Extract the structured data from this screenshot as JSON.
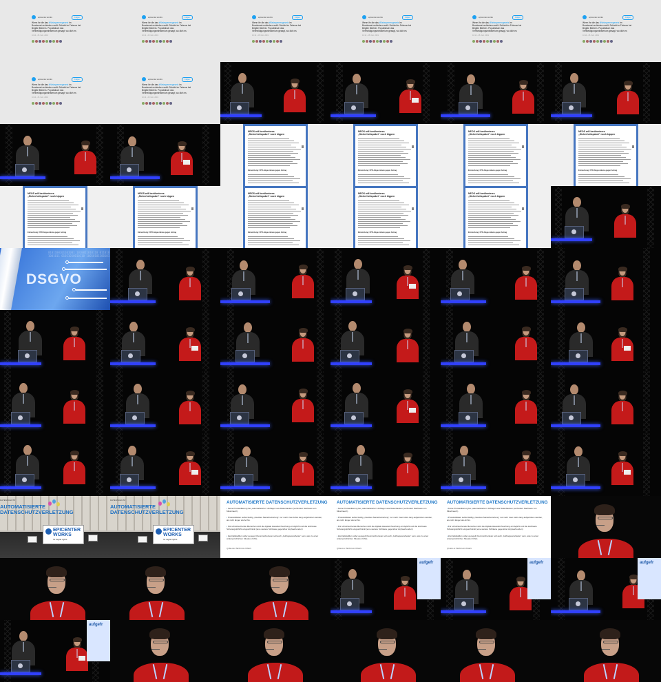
{
  "tweet": {
    "handle": "epicenter.works",
    "follow_label": "Folgen",
    "body_prefix": "Wenn ihr die das",
    "body_link": "#Netzsperrengesetz",
    "body_rest": "im Bundesrat verhindern wollt: Schickt im Februar bei Brigitte Bierlein. Populistisch das Vertheidigungsministerium gesagt, wo dich es",
    "time": "10:14 - 25. Feb. 2019"
  },
  "article": {
    "headline": "NEOS will berühmteres „Sicherheitspaket“ noch kippen",
    "subhead": "Einreichung: FPÖ-Abgeordnete gegen Antrag"
  },
  "dsgvo": {
    "label": "DSGVO",
    "binary": "0101100101101001 1010011010110 0110101001011 01011010010110 10010101100101"
  },
  "protest": {
    "banner_top": "DATENSCHUTZ",
    "title_line1": "AUTOMATISIERTE",
    "title_line2": "DATENSCHUTZVERLETZUNG",
    "epicenter_line1": "EPICENTER",
    "epicenter_line2": "WORKS",
    "epicenter_tagline": "for digital rights"
  },
  "slide": {
    "title": "AUTOMATISIERTE DATENSCHUTZVERLETZUNG",
    "bullets": [
      "Keine Protokollierung bei „automatisierten“ Abfragen aus Datenbanken (verhindert Nachweis von Missbrauch)",
      "Protokolldaten selbst läuftig „zweckes Sanierbeziehung“ nur mehr zwei Jahre lang aufgehoben werden, als nicht länger als Archiv.",
      "Für schutzsuchende Menschen wird die digitale Hausdurchsuchung ermöglicht und die leichteste Schwangstpflicht eingeschränkt (eine weitere Schikane gegenüber Asylwerbenden)",
      "Zentralidpaltfen soller geregelt (Kennzeichenleter soll auch „Auftragsverarbeiter“ sein, was zu einer widersprüchlichen Situation führt)."
    ],
    "source": "QUELLE: BESCHLUSSEN"
  },
  "screen_slide": {
    "word": "aufgefr"
  },
  "colors": {
    "accent_blue": "#1f78c8",
    "stage_light": "#3040ff",
    "shirt_red": "#c41a1a"
  },
  "frame_sequence": [
    "tweet",
    "tweet",
    "tweet",
    "tweet",
    "tweet",
    "tweet",
    "tweet",
    "tweet",
    "stage",
    "stage",
    "stage",
    "stage",
    "stage",
    "stage",
    "article",
    "article",
    "article",
    "article",
    "article",
    "article",
    "article",
    "article",
    "article",
    "stage",
    "dsgvo",
    "stage",
    "stage",
    "stage",
    "stage",
    "stage",
    "stage",
    "stage",
    "stage",
    "stage",
    "stage",
    "stage",
    "stage",
    "stage",
    "stage",
    "stage",
    "stage",
    "stage",
    "stage",
    "stage",
    "stage",
    "stage",
    "stage",
    "stage",
    "protest",
    "protest",
    "slide",
    "slide",
    "slide",
    "closeup",
    "closeup",
    "closeup",
    "closeup",
    "screen",
    "screen",
    "screen",
    "screen",
    "closeup",
    "closeup",
    "closeup",
    "closeup",
    "closeup"
  ]
}
